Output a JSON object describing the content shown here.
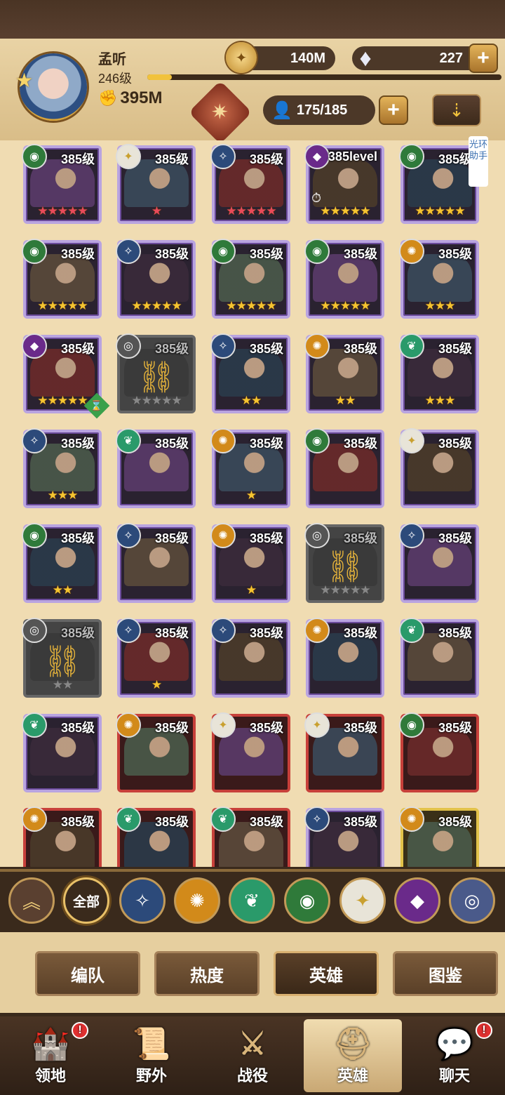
{
  "player": {
    "name": "孟听",
    "level": "246级",
    "power": "395M",
    "xp_fraction": 0.07
  },
  "resources": {
    "gold": "140M",
    "gems": "227"
  },
  "hero_count": "175/185",
  "side_tag": "光环助手",
  "colors": {
    "accent": "#f1c23c",
    "panel": "#f0dcb2",
    "purple_frame": "#b9a4e0",
    "red_frame": "#c7403a",
    "gold_frame": "#e2c24a"
  },
  "heroes": [
    {
      "level": "385级",
      "frame": "purple",
      "faction": "forest",
      "stars": "★★★★★",
      "star_color": "red"
    },
    {
      "level": "385级",
      "frame": "purple",
      "faction": "celestial",
      "stars": "★",
      "star_color": "red"
    },
    {
      "level": "385级",
      "frame": "purple",
      "faction": "lightbearer",
      "stars": "★★★★★",
      "star_color": "red"
    },
    {
      "level": "385level",
      "frame": "purple",
      "faction": "graveborn",
      "stars": "★★★★★",
      "star_color": "gold",
      "clock": true
    },
    {
      "level": "385级",
      "frame": "purple",
      "faction": "forest",
      "stars": "★★★★★",
      "star_color": "gold"
    },
    {
      "level": "385级",
      "frame": "purple",
      "faction": "forest",
      "stars": "★★★★★",
      "star_color": "gold"
    },
    {
      "level": "385级",
      "frame": "purple",
      "faction": "lightbearer",
      "stars": "★★★★★",
      "star_color": "gold"
    },
    {
      "level": "385级",
      "frame": "purple",
      "faction": "forest",
      "stars": "★★★★★",
      "star_color": "gold"
    },
    {
      "level": "385级",
      "frame": "purple",
      "faction": "forest",
      "stars": "★★★★★",
      "star_color": "gold"
    },
    {
      "level": "385级",
      "frame": "purple",
      "faction": "mauler",
      "stars": "★★★",
      "star_color": "gold"
    },
    {
      "level": "385级",
      "frame": "purple",
      "faction": "graveborn",
      "stars": "★★★★★",
      "star_color": "gold",
      "hourglass": true
    },
    {
      "level": "385级",
      "frame": "locked",
      "faction": "locked",
      "stars": "★★★★★",
      "star_color": "grey",
      "chain": true
    },
    {
      "level": "385级",
      "frame": "purple",
      "faction": "lightbearer",
      "stars": "★★",
      "star_color": "gold"
    },
    {
      "level": "385级",
      "frame": "purple",
      "faction": "mauler",
      "stars": "★★",
      "star_color": "gold"
    },
    {
      "level": "385级",
      "frame": "purple",
      "faction": "wilder",
      "stars": "★★★",
      "star_color": "gold"
    },
    {
      "level": "385级",
      "frame": "purple",
      "faction": "lightbearer",
      "stars": "★★★",
      "star_color": "gold"
    },
    {
      "level": "385级",
      "frame": "purple",
      "faction": "wilder",
      "stars": "",
      "star_color": "gold"
    },
    {
      "level": "385级",
      "frame": "purple",
      "faction": "mauler",
      "stars": "★",
      "star_color": "gold"
    },
    {
      "level": "385级",
      "frame": "purple",
      "faction": "forest",
      "stars": "",
      "star_color": "gold"
    },
    {
      "level": "385级",
      "frame": "purple",
      "faction": "celestial",
      "stars": "",
      "star_color": "gold"
    },
    {
      "level": "385级",
      "frame": "purple",
      "faction": "forest",
      "stars": "★★",
      "star_color": "gold"
    },
    {
      "level": "385级",
      "frame": "purple",
      "faction": "lightbearer",
      "stars": "",
      "star_color": "gold"
    },
    {
      "level": "385级",
      "frame": "purple",
      "faction": "mauler",
      "stars": "★",
      "star_color": "gold"
    },
    {
      "level": "385级",
      "frame": "locked",
      "faction": "locked",
      "stars": "★★★★★",
      "star_color": "grey",
      "chain": true
    },
    {
      "level": "385级",
      "frame": "purple",
      "faction": "lightbearer",
      "stars": "",
      "star_color": "gold"
    },
    {
      "level": "385级",
      "frame": "locked",
      "faction": "locked",
      "stars": "★★",
      "star_color": "grey",
      "chain": true
    },
    {
      "level": "385级",
      "frame": "purple",
      "faction": "lightbearer",
      "stars": "★",
      "star_color": "gold"
    },
    {
      "level": "385级",
      "frame": "purple",
      "faction": "lightbearer",
      "stars": "",
      "star_color": "gold"
    },
    {
      "level": "385级",
      "frame": "purple",
      "faction": "mauler",
      "stars": "",
      "star_color": "gold"
    },
    {
      "level": "385级",
      "frame": "purple",
      "faction": "wilder",
      "stars": "",
      "star_color": "gold"
    },
    {
      "level": "385级",
      "frame": "purple",
      "faction": "wilder",
      "stars": "",
      "star_color": "gold"
    },
    {
      "level": "385级",
      "frame": "red",
      "faction": "mauler",
      "stars": "",
      "star_color": "gold"
    },
    {
      "level": "385级",
      "frame": "red",
      "faction": "celestial",
      "stars": "",
      "star_color": "gold"
    },
    {
      "level": "385级",
      "frame": "red",
      "faction": "celestial",
      "stars": "",
      "star_color": "gold"
    },
    {
      "level": "385级",
      "frame": "red",
      "faction": "forest",
      "stars": "",
      "star_color": "gold"
    },
    {
      "level": "385级",
      "frame": "red",
      "faction": "mauler",
      "stars": "",
      "star_color": "gold"
    },
    {
      "level": "385级",
      "frame": "red",
      "faction": "wilder",
      "stars": "",
      "star_color": "gold"
    },
    {
      "level": "385级",
      "frame": "red",
      "faction": "wilder",
      "stars": "",
      "star_color": "gold"
    },
    {
      "level": "385级",
      "frame": "purple",
      "faction": "lightbearer",
      "stars": "",
      "star_color": "gold"
    },
    {
      "level": "385级",
      "frame": "gold",
      "faction": "mauler",
      "stars": "",
      "star_color": "gold"
    }
  ],
  "filters": {
    "all_label": "全部"
  },
  "tabs": [
    {
      "label": "编队",
      "active": false
    },
    {
      "label": "热度",
      "active": false
    },
    {
      "label": "英雄",
      "active": true
    },
    {
      "label": "图鉴",
      "active": false
    }
  ],
  "nav": [
    {
      "label": "领地",
      "icon": "castle-icon",
      "badge": "!"
    },
    {
      "label": "野外",
      "icon": "map-scroll-icon",
      "badge": ""
    },
    {
      "label": "战役",
      "icon": "sword-shield-icon",
      "badge": ""
    },
    {
      "label": "英雄",
      "icon": "helmet-icon",
      "badge": "",
      "active": true
    },
    {
      "label": "聊天",
      "icon": "chat-icon",
      "badge": "!"
    }
  ]
}
